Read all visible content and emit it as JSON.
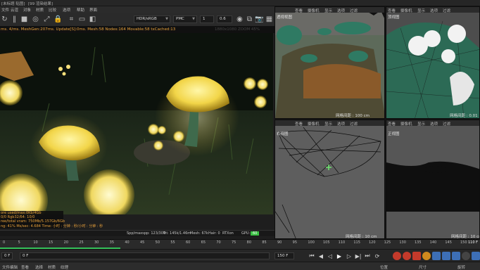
{
  "title_bar": {
    "left_text": "[未标题 贴图]",
    "middle_text": "[99 渲染结果]"
  },
  "render_menu": [
    "文件",
    "云渲",
    "对象",
    "材质",
    "比较",
    "选项",
    "帮助",
    "界面"
  ],
  "render_toolbar": {
    "channel_box": "[通道:4]",
    "color_space": "HDR/sRGB",
    "mode": "PMC",
    "value_a": "1",
    "value_b": "0.6"
  },
  "status_line": {
    "text": "ms. 4/ms. MeshGen:207ms. Update[S]:0ms. Mesh:58 Nodes:164 Movable:58 txCached:13",
    "faded": "1880x1080 ZOOM 45%"
  },
  "render_stats": [
    "ore used/max:0Kb/4Gb",
    "0/0          Rgb32/64: 10/0",
    "ree/total vram: 750Mb/5.157Gb/6Gb",
    "ng: 41%  Ms/sec: 4.684  Time: 小时 : 分钟 : 秒/小时 : 分钟 : 秒"
  ],
  "info_bar": {
    "spp": "Spp/maxspp: 123/300",
    "tri": "Tri: 145k/1.46m",
    "mesh": "Mesh: 67k",
    "hair": "Hair: 0",
    "rtx": "RTXon",
    "gpu_label": "GPU:",
    "gpu_value": "60"
  },
  "viewports": [
    {
      "title": "透视视图",
      "menus": [
        "查看",
        "摄像机",
        "显示",
        "选项",
        "过滤"
      ],
      "grid": "网格间距 : 100 cm"
    },
    {
      "title": "顶视图",
      "menus": [
        "查看",
        "摄像机",
        "显示",
        "选项",
        "过滤"
      ],
      "grid": "网格间距 : 0.01"
    },
    {
      "title": "右视图",
      "menus": [
        "查看",
        "摄像机",
        "显示",
        "选项",
        "过滤"
      ],
      "grid": "网格间距 : 10 cm"
    },
    {
      "title": "正视图",
      "menus": [
        "查看",
        "摄像机",
        "显示",
        "选项",
        "过滤"
      ],
      "grid": "网格间距 : 10 cm"
    }
  ],
  "timeline": {
    "ticks": [
      "0",
      "5",
      "10",
      "15",
      "20",
      "25",
      "30",
      "35",
      "40",
      "45",
      "50",
      "55",
      "60",
      "65",
      "70",
      "75",
      "80",
      "85",
      "90",
      "95",
      "100",
      "105",
      "110",
      "115",
      "120",
      "125",
      "130",
      "135",
      "140",
      "145",
      "150"
    ],
    "right_label": "110 F",
    "progress": 0.25
  },
  "transport": {
    "start_frame": "0 F",
    "current_frame": "0 F",
    "end_frame_a": "150 F",
    "end_frame_b": "150 F"
  },
  "bottom_menu": [
    "文件",
    "编辑",
    "查看",
    "选择",
    "材质",
    "纹理"
  ],
  "bottom_right": [
    "位置",
    "尺寸",
    "旋转"
  ],
  "colors": {
    "accent_green": "#35c15a",
    "gpu_green": "#3ac043",
    "status_orange": "#e9a23b",
    "render_bg": "#0d120d"
  }
}
